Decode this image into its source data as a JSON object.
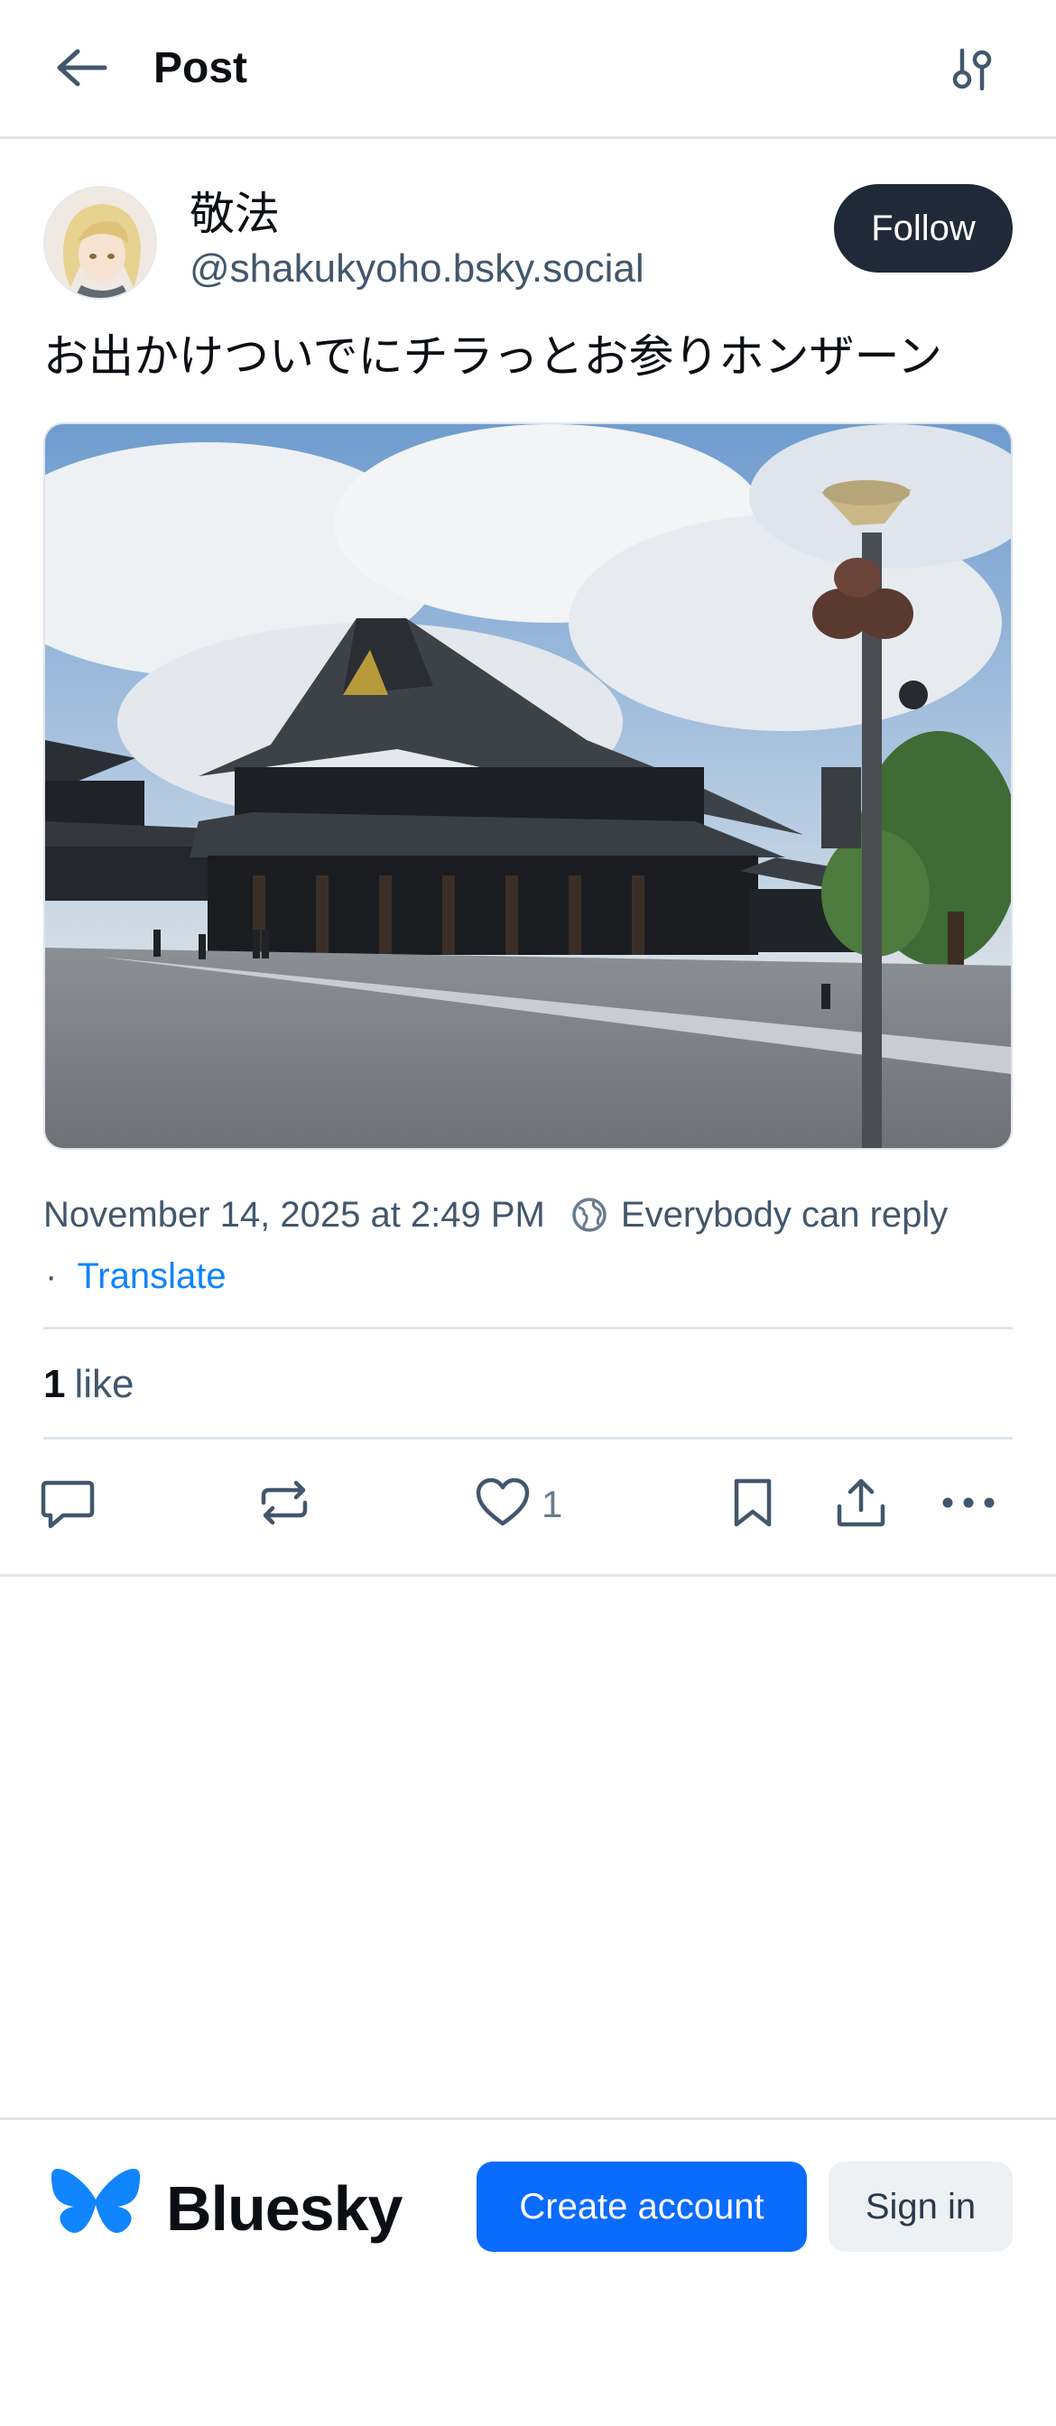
{
  "header": {
    "title": "Post",
    "back_icon": "arrow-left-icon",
    "filter_icon": "sliders-icon"
  },
  "author": {
    "display_name": "敬法",
    "handle": "@shakukyoho.bsky.social",
    "follow_label": "Follow"
  },
  "post": {
    "text": "お出かけついでにチラっとお参りホンザーン",
    "image_description_icon": "photo-temple",
    "timestamp": "November 14, 2025 at 2:49 PM",
    "reply_setting": "Everybody can reply",
    "separator": "·",
    "translate_label": "Translate",
    "likes_count": "1",
    "likes_label": "like"
  },
  "actions": {
    "reply_icon": "comment-icon",
    "repost_icon": "repost-icon",
    "like_icon": "heart-icon",
    "like_count": "1",
    "bookmark_icon": "bookmark-icon",
    "share_icon": "share-icon",
    "more_icon": "ellipsis-icon"
  },
  "footer": {
    "brand_name": "Bluesky",
    "create_account_label": "Create account",
    "sign_in_label": "Sign in"
  },
  "colors": {
    "accent": "#0a6bff",
    "link": "#1083fe",
    "follow_bg": "#1f2937",
    "muted_text": "#42576c",
    "divider": "#dfe5ea"
  }
}
